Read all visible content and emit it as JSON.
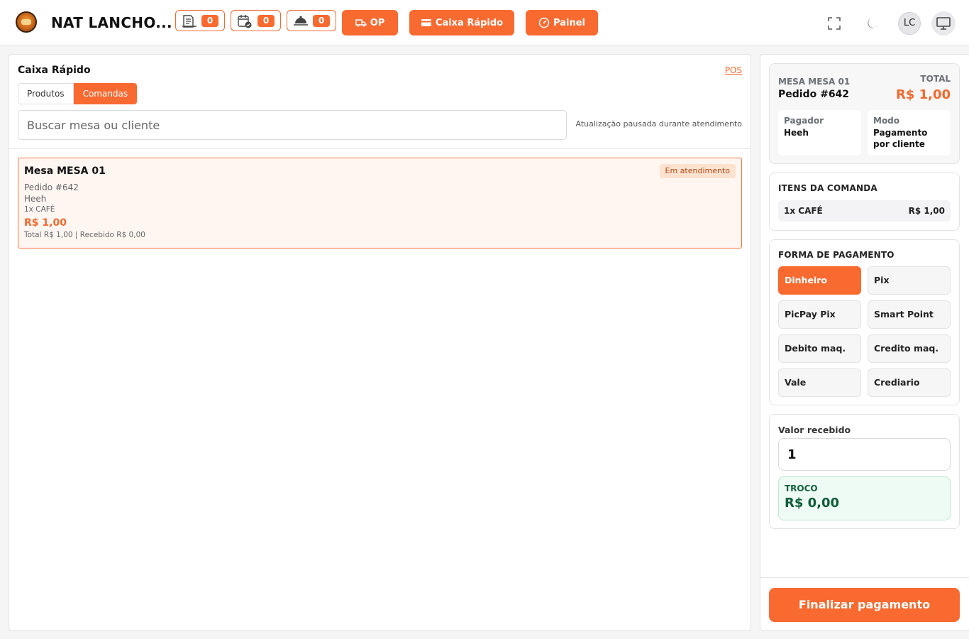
{
  "header": {
    "app_title": "NAT LANCHO...",
    "counters": [
      {
        "icon": "receipt-icon",
        "count": "0"
      },
      {
        "icon": "calendar-check-icon",
        "count": "0"
      },
      {
        "icon": "delivery-icon",
        "count": "0"
      }
    ],
    "buttons": {
      "op": "OP",
      "caixa_rapido": "Caixa Rápido",
      "painel": "Painel"
    },
    "user_initials": "LC"
  },
  "left": {
    "title": "Caixa Rápido",
    "pos_link": "POS",
    "tabs": [
      {
        "label": "Produtos",
        "active": false
      },
      {
        "label": "Comandas",
        "active": true
      }
    ],
    "search": {
      "placeholder": "Buscar mesa ou cliente",
      "value": ""
    },
    "paused_notice": "Atualização pausada durante atendimento",
    "orders": [
      {
        "title": "Mesa MESA 01",
        "status": "Em atendimento",
        "order": "Pedido #642",
        "client": "Heeh",
        "items": "1x CAFÉ",
        "amount": "R$ 1,00",
        "summary": "Total R$ 1,00 | Recebido R$ 0,00"
      }
    ]
  },
  "right": {
    "summary": {
      "mesa": "MESA MESA 01",
      "order": "Pedido #642",
      "total_label": "TOTAL",
      "total": "R$ 1,00",
      "payer_label": "Pagador",
      "payer": "Heeh",
      "mode_label": "Modo",
      "mode": "Pagamento por cliente"
    },
    "items_title": "ITENS DA COMANDA",
    "items": [
      {
        "name": "1x CAFÉ",
        "price": "R$ 1,00"
      }
    ],
    "payment_title": "FORMA DE PAGAMENTO",
    "payment_methods": [
      {
        "label": "Dinheiro",
        "active": true
      },
      {
        "label": "Pix",
        "active": false
      },
      {
        "label": "PicPay Pix",
        "active": false
      },
      {
        "label": "Smart Point",
        "active": false
      },
      {
        "label": "Debito maq.",
        "active": false
      },
      {
        "label": "Credito maq.",
        "active": false
      },
      {
        "label": "Vale",
        "active": false
      },
      {
        "label": "Crediario",
        "active": false
      }
    ],
    "received_label": "Valor recebido",
    "received_value": "1",
    "change_label": "TROCO",
    "change_value": "R$ 0,00",
    "finalize_label": "Finalizar pagamento"
  },
  "colors": {
    "accent": "#f96a31",
    "change_bg": "#eefaf4",
    "change_text": "#0f5c38"
  }
}
